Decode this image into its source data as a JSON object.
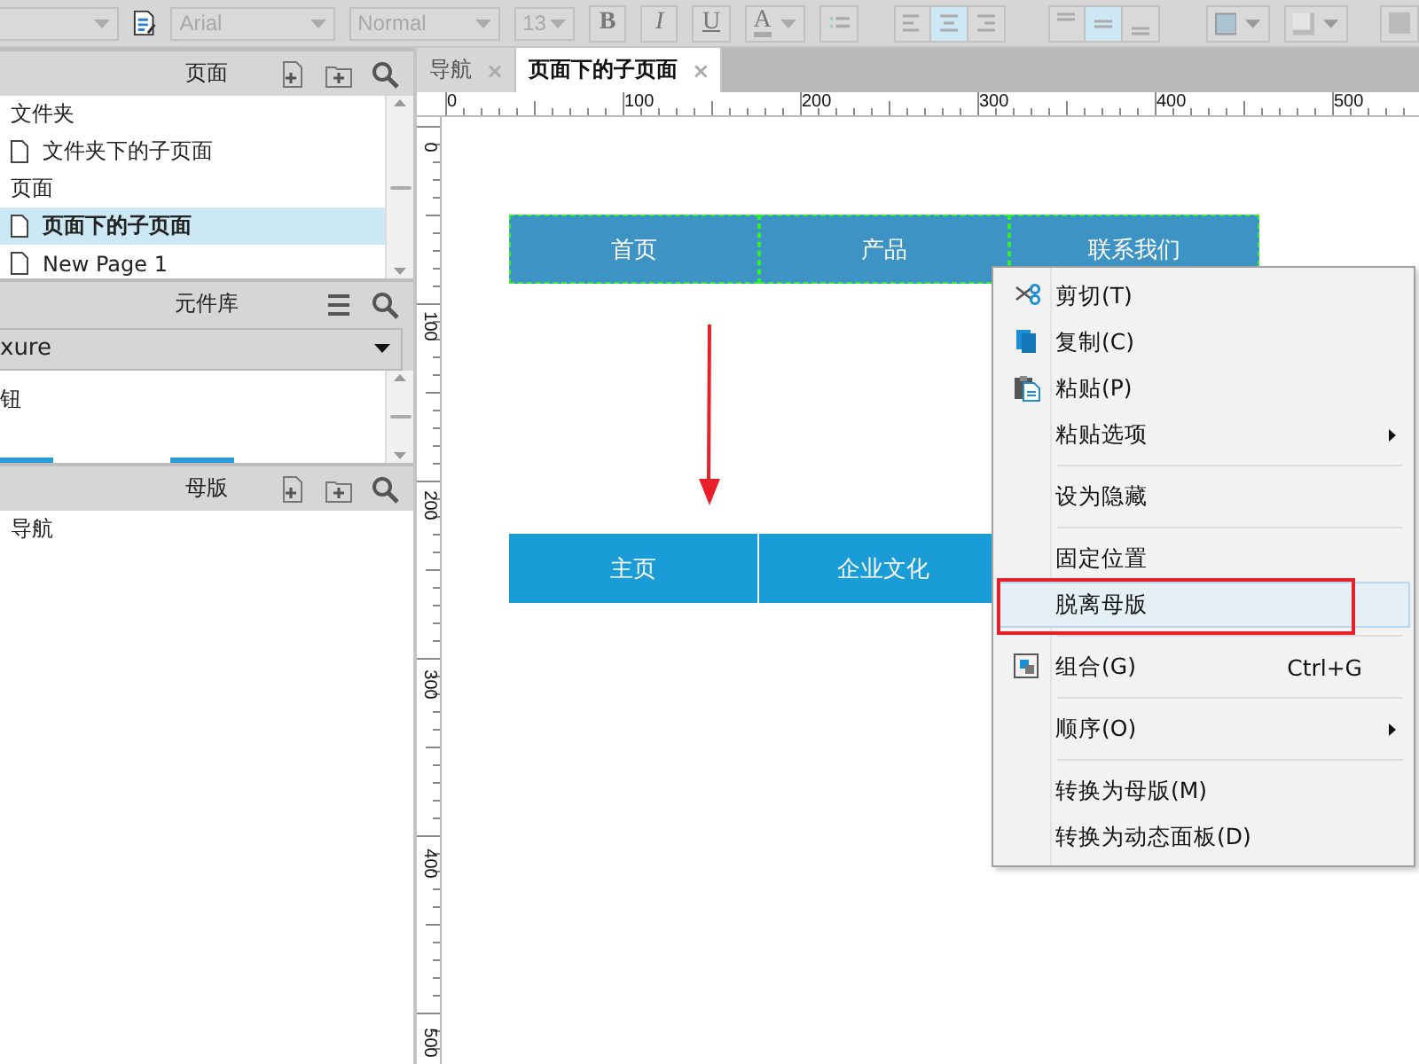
{
  "toolbar": {
    "items": [
      {
        "kind": "combo",
        "value": ""
      },
      {
        "kind": "page-icon"
      },
      {
        "kind": "combo",
        "value": "Arial"
      },
      {
        "kind": "combo",
        "value": "Normal"
      },
      {
        "kind": "combo",
        "value": "13"
      },
      {
        "kind": "bold",
        "label": "B"
      },
      {
        "kind": "italic",
        "label": "I"
      },
      {
        "kind": "underline",
        "label": "U"
      },
      {
        "kind": "font-color",
        "label": "A"
      },
      {
        "kind": "bullets"
      },
      {
        "kind": "halign",
        "options": [
          {
            "selected": false
          },
          {
            "selected": true
          },
          {
            "selected": false
          }
        ]
      },
      {
        "kind": "valign",
        "options": [
          {
            "selected": false
          },
          {
            "selected": true
          },
          {
            "selected": false
          }
        ]
      },
      {
        "kind": "fill"
      },
      {
        "kind": "border"
      },
      {
        "kind": "more"
      }
    ]
  },
  "pages_panel": {
    "title": "页面",
    "tree": [
      {
        "label": "文件夹",
        "kind": "folder",
        "selected": false,
        "children": [
          {
            "label": "文件夹下的子页面",
            "kind": "page",
            "selected": false
          }
        ]
      },
      {
        "label": "页面",
        "kind": "folder",
        "selected": false,
        "children": [
          {
            "label": "页面下的子页面",
            "kind": "page",
            "selected": true
          },
          {
            "label": "New Page 1",
            "kind": "page",
            "selected": false
          }
        ]
      }
    ]
  },
  "library_panel": {
    "title": "元件库",
    "dropdown": {
      "value": "xure"
    },
    "items": [
      "钮"
    ]
  },
  "masters_panel": {
    "title": "母版",
    "items": [
      "导航"
    ]
  },
  "tabs": [
    {
      "label": "导航",
      "close": "×",
      "selected": false
    },
    {
      "label": "页面下的子页面",
      "close": "×",
      "selected": true
    }
  ],
  "rulers": {
    "horizontal": [
      "0",
      "100",
      "200",
      "300",
      "400",
      "500"
    ],
    "vertical": [
      "0",
      "100",
      "200",
      "300",
      "400",
      "500"
    ]
  },
  "canvas": {
    "rows": [
      [
        {
          "label": "首页",
          "master": true
        },
        {
          "label": "产品",
          "master": true
        },
        {
          "label": "联系我们",
          "master": true
        }
      ],
      [
        {
          "label": "主页",
          "master": false
        },
        {
          "label": "企业文化",
          "master": false
        }
      ]
    ]
  },
  "context_menu": {
    "groups": [
      [
        {
          "label": "剪切(T)",
          "kind": "cut",
          "selected": false
        },
        {
          "label": "复制(C)",
          "kind": "copy",
          "selected": false
        },
        {
          "label": "粘贴(P)",
          "kind": "paste",
          "selected": false
        },
        {
          "label": "粘贴选项",
          "kind": "plain",
          "submenu": true,
          "selected": false
        }
      ],
      [
        {
          "label": "设为隐藏",
          "kind": "plain",
          "selected": false
        }
      ],
      [
        {
          "label": "固定位置",
          "kind": "plain",
          "selected": false
        },
        {
          "label": "脱离母版",
          "kind": "plain",
          "selected": true,
          "highlighted": true
        }
      ],
      [
        {
          "label": "组合(G)",
          "kind": "group",
          "shortcut": "Ctrl+G",
          "selected": false
        }
      ],
      [
        {
          "label": "顺序(O)",
          "kind": "plain",
          "submenu": true,
          "selected": false
        }
      ],
      [
        {
          "label": "转换为母版(M)",
          "kind": "plain",
          "selected": false
        },
        {
          "label": "转换为动态面板(D)",
          "kind": "plain",
          "selected": false
        }
      ]
    ]
  }
}
